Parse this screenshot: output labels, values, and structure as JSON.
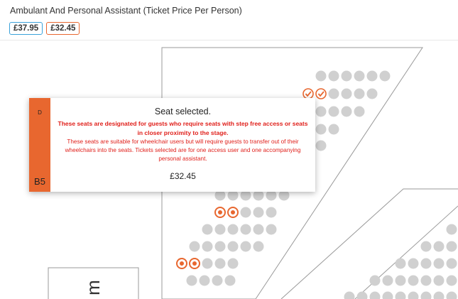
{
  "header": {
    "title": "Ambulant And Personal Assistant (Ticket Price Per Person)"
  },
  "prices": [
    {
      "label": "£37.95",
      "color": "#3ba2da"
    },
    {
      "label": "£32.45",
      "color": "#e8672f"
    }
  ],
  "tooltip": {
    "row": "D",
    "seat": "B5",
    "title": "Seat selected.",
    "warning": "These seats are designated for guests who require seats with step free access or seats in closer proximity to the stage.",
    "info": "These seats are suitable for wheelchair users but will require guests to transfer out of their wheelchairs into the seats. Tickets selected are for one access user and one accompanying personal assistant.",
    "price": "£32.45"
  },
  "map": {
    "stage_letter": "m"
  },
  "colors": {
    "accent": "#e8672f",
    "warning_text": "#e0201b",
    "seat_available": "#d0d0d0",
    "outline": "#999999",
    "secondary_price": "#3ba2da"
  },
  "icons": [
    "check-icon",
    "selected-seat-icon"
  ]
}
